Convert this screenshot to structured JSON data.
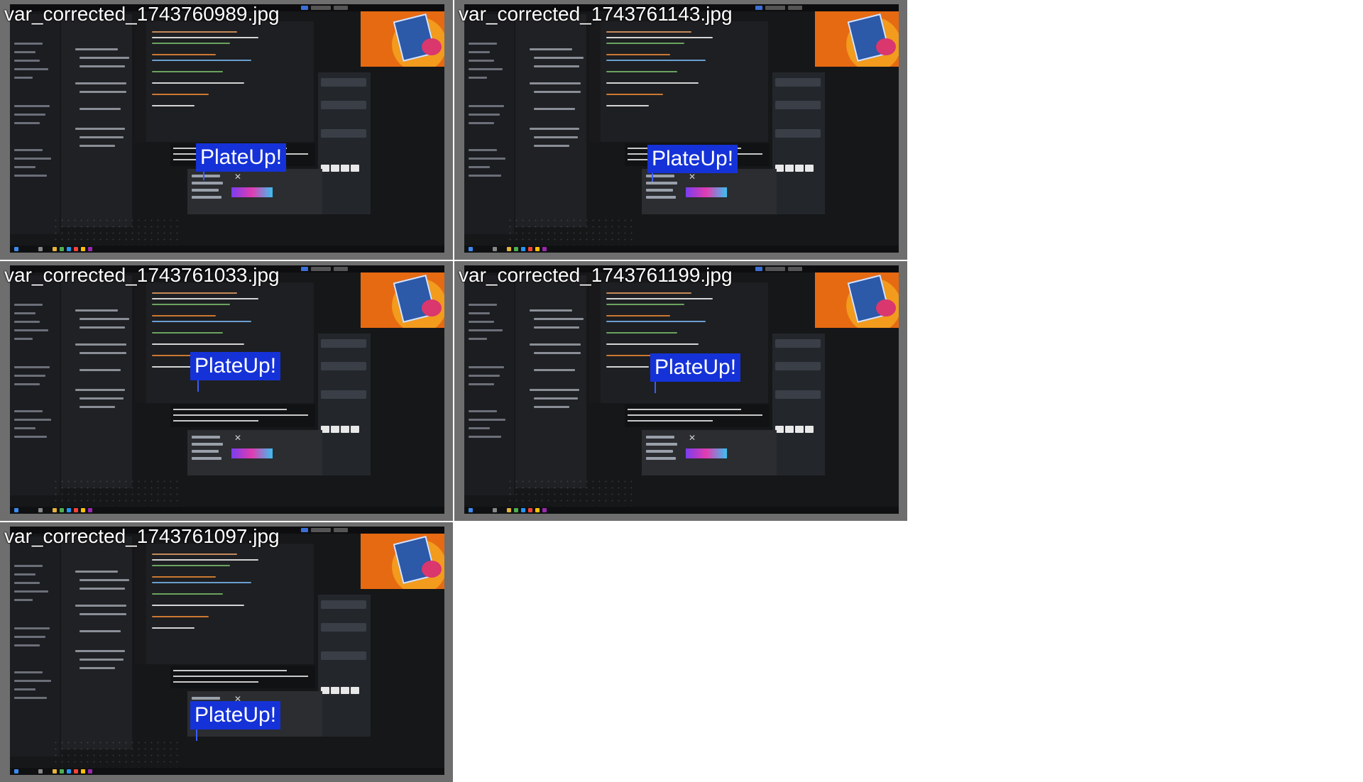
{
  "tiles": [
    {
      "filename": "var_corrected_1743760989.jpg",
      "label": "PlateUp!"
    },
    {
      "filename": "var_corrected_1743761143.jpg",
      "label": "PlateUp!"
    },
    {
      "filename": "var_corrected_1743761033.jpg",
      "label": "PlateUp!"
    },
    {
      "filename": "var_corrected_1743761199.jpg",
      "label": "PlateUp!"
    },
    {
      "filename": "var_corrected_1743761097.jpg",
      "label": "PlateUp!"
    }
  ],
  "colors": {
    "label_background": "#1532d8",
    "tile_frame": "#6e6e6e",
    "desktop_background": "#161719"
  }
}
